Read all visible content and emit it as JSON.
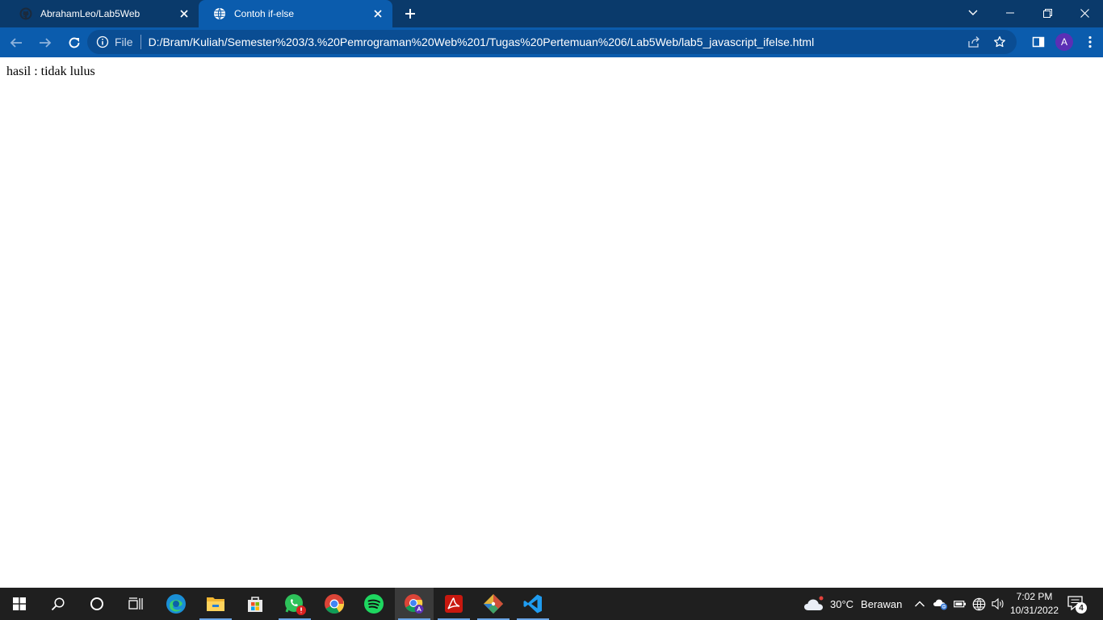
{
  "browser": {
    "tabs": [
      {
        "title": "AbrahamLeo/Lab5Web",
        "active": false,
        "favicon": "github-icon"
      },
      {
        "title": "Contoh if-else",
        "active": true,
        "favicon": "globe-icon"
      }
    ],
    "omnibox": {
      "scheme_label": "File",
      "url": "D:/Bram/Kuliah/Semester%203/3.%20Pemrograman%20Web%201/Tugas%20Pertemuan%206/Lab5Web/lab5_javascript_ifelse.html"
    },
    "profile_initial": "A",
    "colors": {
      "frame": "#0a3a6b",
      "toolbar": "#0b5cad",
      "omnibox": "#0a4d93",
      "avatar": "#5b2fb5"
    }
  },
  "page": {
    "result_text": "hasil : tidak lulus"
  },
  "taskbar": {
    "apps": [
      {
        "name": "edge-icon"
      },
      {
        "name": "file-explorer-icon",
        "running": true
      },
      {
        "name": "microsoft-store-icon"
      },
      {
        "name": "whatsapp-icon",
        "running": true
      },
      {
        "name": "chrome-icon"
      },
      {
        "name": "spotify-icon"
      },
      {
        "name": "chrome-profile-icon",
        "running": true,
        "active": true
      },
      {
        "name": "acrobat-icon",
        "running": true
      },
      {
        "name": "git-icon",
        "running": true
      },
      {
        "name": "vscode-icon",
        "running": true
      }
    ],
    "weather": {
      "temperature": "30°C",
      "condition": "Berawan"
    },
    "clock": {
      "time": "7:02 PM",
      "date": "10/31/2022"
    },
    "notification_count": "4"
  }
}
